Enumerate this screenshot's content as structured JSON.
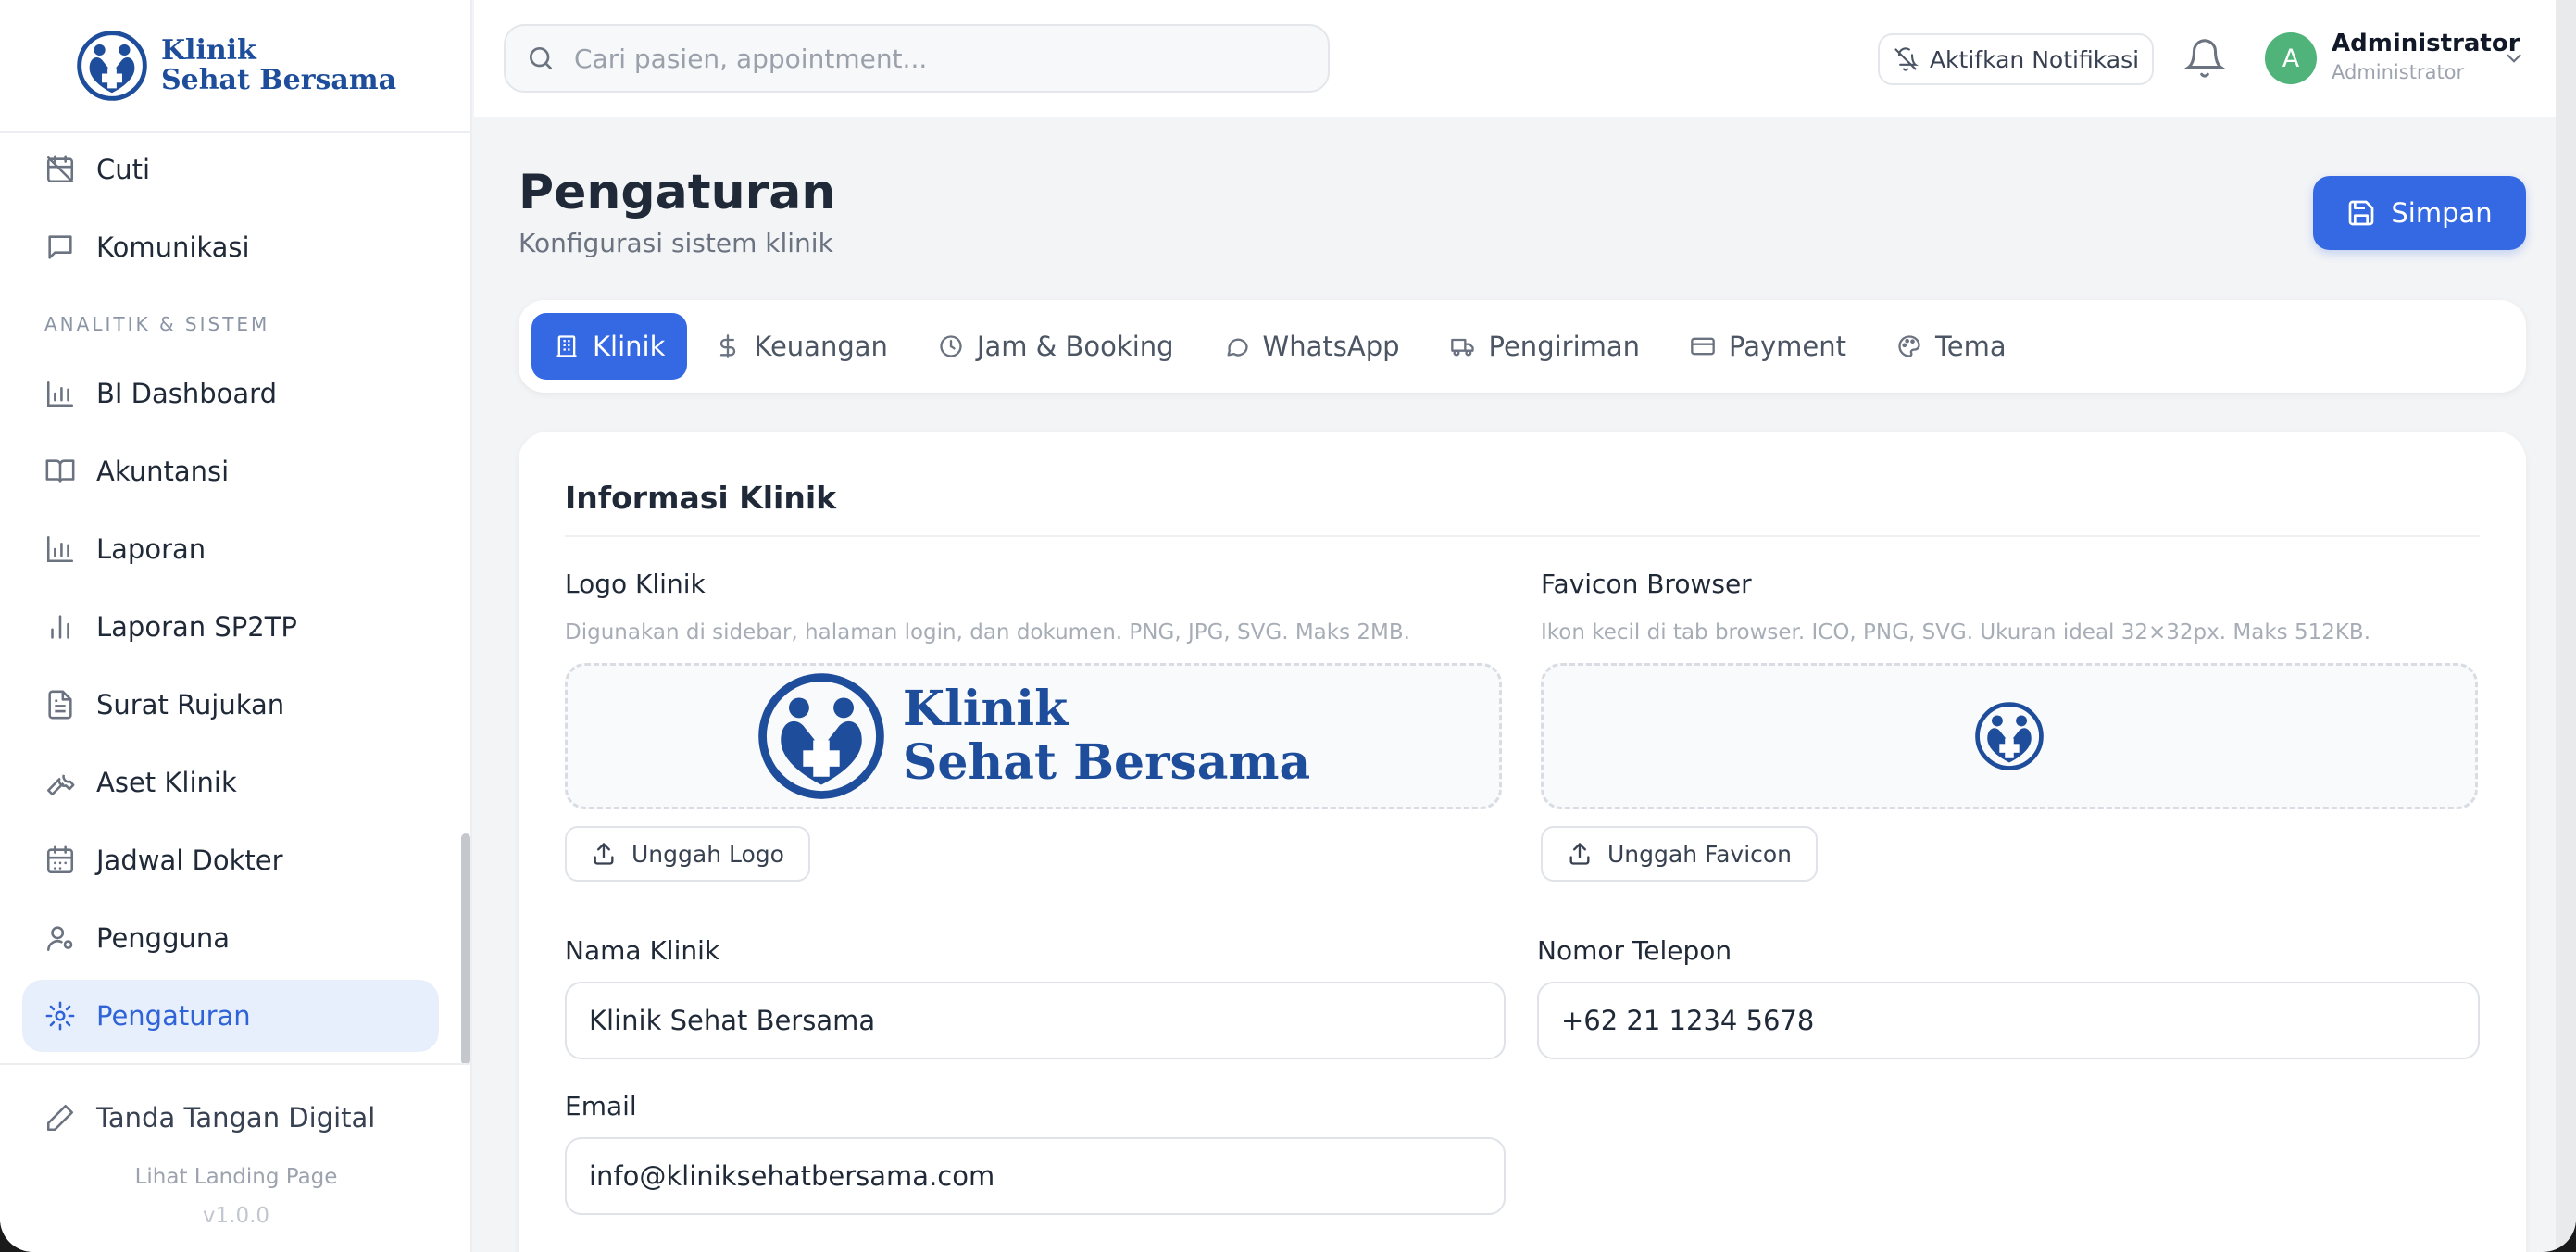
{
  "brand": {
    "line1": "Klinik",
    "line2": "Sehat Bersama"
  },
  "sidebar": {
    "items_top": [
      {
        "label": "Cuti",
        "icon": "calendar-off-icon"
      },
      {
        "label": "Komunikasi",
        "icon": "message-square-icon"
      }
    ],
    "section_label": "ANALITIK & SISTEM",
    "items": [
      {
        "label": "BI Dashboard",
        "icon": "bar-chart-icon"
      },
      {
        "label": "Akuntansi",
        "icon": "book-open-icon"
      },
      {
        "label": "Laporan",
        "icon": "bar-chart-icon"
      },
      {
        "label": "Laporan SP2TP",
        "icon": "bar-chart-2-icon"
      },
      {
        "label": "Surat Rujukan",
        "icon": "file-text-icon"
      },
      {
        "label": "Aset Klinik",
        "icon": "wrench-icon"
      },
      {
        "label": "Jadwal Dokter",
        "icon": "calendar-icon"
      },
      {
        "label": "Pengguna",
        "icon": "user-cog-icon"
      },
      {
        "label": "Pengaturan",
        "icon": "gear-icon",
        "active": true
      }
    ],
    "signature": "Tanda Tangan Digital",
    "landing": "Lihat Landing Page",
    "version": "v1.0.0"
  },
  "header": {
    "search_placeholder": "Cari pasien, appointment...",
    "notif_button": "Aktifkan Notifikasi",
    "user_initial": "A",
    "user_name": "Administrator",
    "user_role": "Administrator"
  },
  "page": {
    "title": "Pengaturan",
    "subtitle": "Konfigurasi sistem klinik",
    "save_label": "Simpan"
  },
  "tabs": [
    {
      "label": "Klinik",
      "icon": "building-icon",
      "active": true
    },
    {
      "label": "Keuangan",
      "icon": "dollar-icon"
    },
    {
      "label": "Jam & Booking",
      "icon": "clock-icon"
    },
    {
      "label": "WhatsApp",
      "icon": "chat-bubble-icon"
    },
    {
      "label": "Pengiriman",
      "icon": "truck-icon"
    },
    {
      "label": "Payment",
      "icon": "credit-card-icon"
    },
    {
      "label": "Tema",
      "icon": "palette-icon"
    }
  ],
  "form": {
    "card_title": "Informasi Klinik",
    "logo_label": "Logo Klinik",
    "logo_help": "Digunakan di sidebar, halaman login, dan dokumen. PNG, JPG, SVG. Maks 2MB.",
    "logo_upload": "Unggah Logo",
    "favicon_label": "Favicon Browser",
    "favicon_help": "Ikon kecil di tab browser. ICO, PNG, SVG. Ukuran ideal 32×32px. Maks 512KB.",
    "favicon_upload": "Unggah Favicon",
    "name_label": "Nama Klinik",
    "name_value": "Klinik Sehat Bersama",
    "phone_label": "Nomor Telepon",
    "phone_value": "+62 21 1234 5678",
    "email_label": "Email",
    "email_value": "info@kliniksehatbersama.com"
  },
  "colors": {
    "accent": "#3568e3",
    "brand": "#1e4d9b",
    "active_bg": "#e8effc",
    "avatar": "#4fb37a"
  }
}
